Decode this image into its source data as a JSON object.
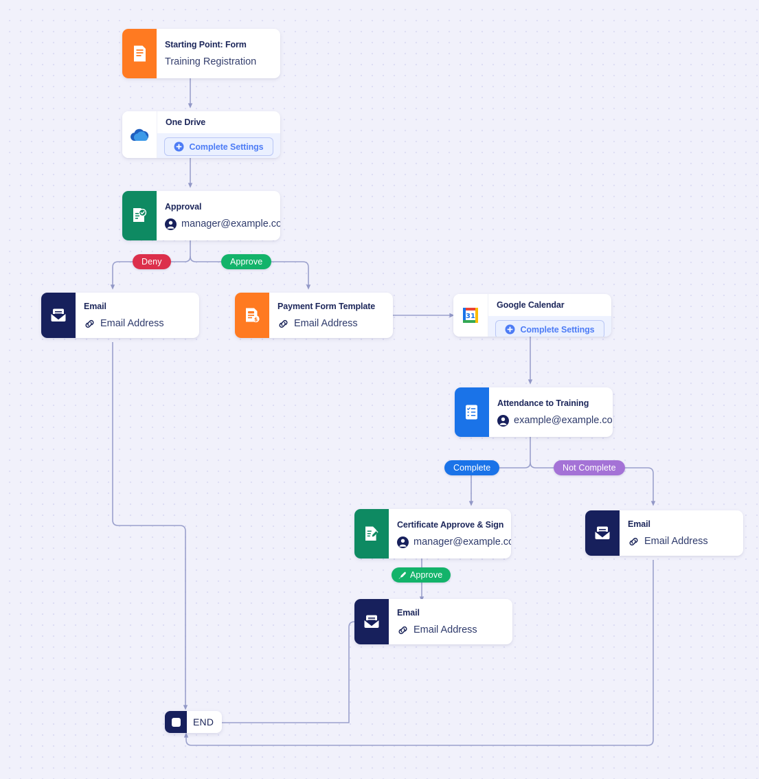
{
  "canvas": {
    "background_color": "#f1f1fb",
    "dot_color": "#dedef4",
    "edge_color": "#9aa0cc"
  },
  "nodes": [
    {
      "id": "start",
      "title": "Starting Point: Form",
      "subtitle": "Training Registration",
      "icon": "form-document-icon",
      "tile_color": "#ff7a21"
    },
    {
      "id": "onedrive",
      "title": "One Drive",
      "button_label": "Complete Settings",
      "icon": "onedrive-cloud-icon",
      "tile_color": "#ffffff"
    },
    {
      "id": "approval",
      "title": "Approval",
      "subtitle": "manager@example.com",
      "icon": "approval-check-document-icon",
      "tile_color": "#0e8a62"
    },
    {
      "id": "email-deny",
      "title": "Email",
      "subtitle": "Email Address",
      "icon": "envelope-icon",
      "tile_color": "#17205c"
    },
    {
      "id": "payment-form",
      "title": "Payment Form Template",
      "subtitle": "Email Address",
      "icon": "payment-document-icon",
      "tile_color": "#ff7a21"
    },
    {
      "id": "google-calendar",
      "title": "Google Calendar",
      "button_label": "Complete Settings",
      "icon": "google-calendar-icon",
      "tile_color": "#ffffff"
    },
    {
      "id": "attendance",
      "title": "Attendance to Training",
      "subtitle": "example@example.com",
      "icon": "checklist-icon",
      "tile_color": "#1a73e8"
    },
    {
      "id": "certificate",
      "title": "Certificate Approve & Sign",
      "subtitle": "manager@example.com",
      "icon": "signature-document-icon",
      "tile_color": "#0e8a62"
    },
    {
      "id": "email-notcomplete",
      "title": "Email",
      "subtitle": "Email Address",
      "icon": "envelope-icon",
      "tile_color": "#17205c"
    },
    {
      "id": "email-certificate",
      "title": "Email",
      "subtitle": "Email Address",
      "icon": "envelope-icon",
      "tile_color": "#17205c"
    },
    {
      "id": "end",
      "title": "END",
      "icon": "stop-square-icon",
      "tile_color": "#17205c"
    }
  ],
  "branch_labels": [
    {
      "id": "deny",
      "label": "Deny",
      "color": "#dc2f4b"
    },
    {
      "id": "approve",
      "label": "Approve",
      "color": "#13b36a"
    },
    {
      "id": "complete",
      "label": "Complete",
      "color": "#1a73e8"
    },
    {
      "id": "not-complete",
      "label": "Not Complete",
      "color": "#a472d6"
    },
    {
      "id": "sign-approve",
      "label": "Approve",
      "color": "#13b36a",
      "icon": "signature-pen-icon"
    }
  ]
}
